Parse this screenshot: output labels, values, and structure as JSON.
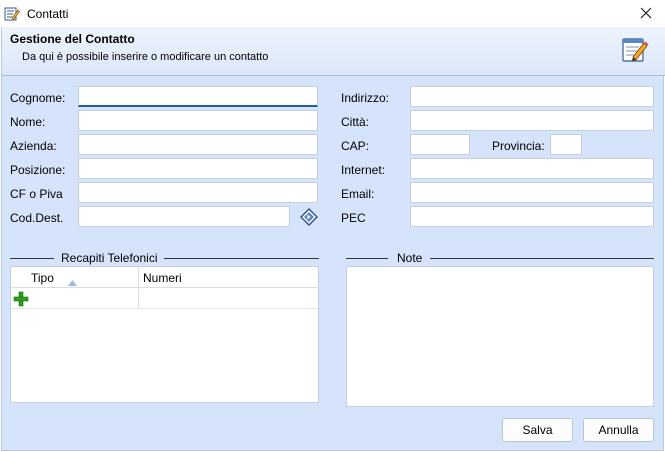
{
  "window": {
    "title": "Contatti",
    "close_icon": "close-icon",
    "app_icon": "edit-contact-icon"
  },
  "header": {
    "title": "Gestione del Contatto",
    "subtitle": "Da qui è possibile inserire o modificare un contatto",
    "icon": "notepad-pencil-icon"
  },
  "form": {
    "cognome": {
      "label": "Cognome:",
      "value": ""
    },
    "nome": {
      "label": "Nome:",
      "value": ""
    },
    "azienda": {
      "label": "Azienda:",
      "value": ""
    },
    "posizione": {
      "label": "Posizione:",
      "value": ""
    },
    "cf_piva": {
      "label": "CF o Piva",
      "value": ""
    },
    "cod_dest": {
      "label": "Cod.Dest.",
      "value": ""
    },
    "indirizzo": {
      "label": "Indirizzo:",
      "value": ""
    },
    "citta": {
      "label": "Città:",
      "value": ""
    },
    "cap": {
      "label": "CAP:",
      "value": ""
    },
    "provincia": {
      "label": "Provincia:",
      "value": ""
    },
    "internet": {
      "label": "Internet:",
      "value": ""
    },
    "email": {
      "label": "Email:",
      "value": ""
    },
    "pec": {
      "label": "PEC",
      "value": ""
    }
  },
  "phones": {
    "title": "Recapiti Telefonici",
    "columns": [
      "Tipo",
      "Numeri"
    ],
    "sort_column": "Tipo",
    "rows": []
  },
  "notes": {
    "title": "Note",
    "value": ""
  },
  "buttons": {
    "save": "Salva",
    "cancel": "Annulla"
  },
  "colors": {
    "background": "#d5e4fb",
    "focus_underline": "#1f5fa8",
    "add_icon": "#2f9e1f"
  }
}
